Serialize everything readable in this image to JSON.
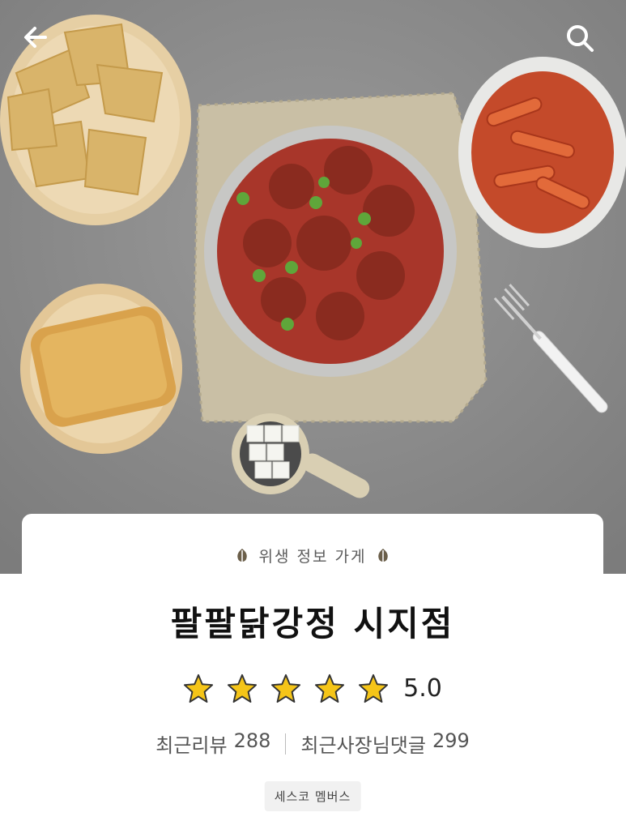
{
  "topbar": {
    "back_icon": "arrow-left-icon",
    "search_icon": "search-icon"
  },
  "hero": {
    "description": ""
  },
  "card": {
    "badge_text": "위생 정보 가게",
    "badge_icon": "leaf-icon",
    "store_name": "팔팔닭강정 시지점",
    "rating": {
      "stars": 5,
      "max_stars": 5,
      "value": "5.0",
      "star_color": "#f5c518"
    },
    "recent_review_label": "최근리뷰",
    "recent_review_count": "288",
    "owner_reply_label": "최근사장님댓글",
    "owner_reply_count": "299",
    "member_chip": "세스코 멤버스"
  }
}
